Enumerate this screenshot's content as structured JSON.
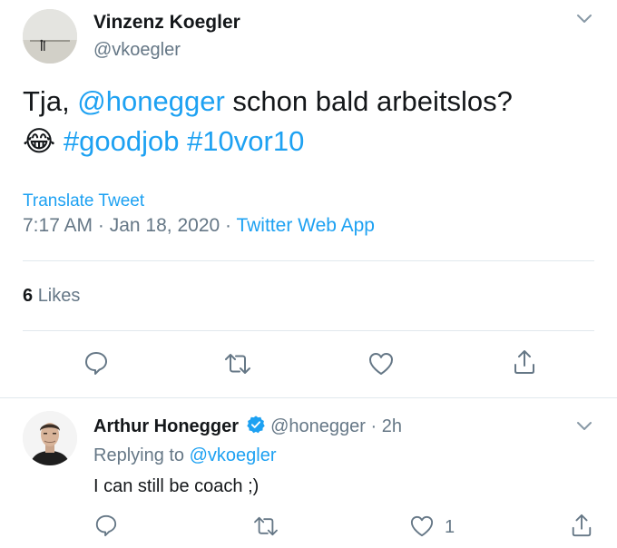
{
  "main_tweet": {
    "author_name": "Vinzenz Koegler",
    "author_handle": "@vkoegler",
    "text_prefix": "Tja, ",
    "mention": "@honegger",
    "text_rest": " schon bald arbeitslos?",
    "emoji": "😂",
    "hashtag1": "#goodjob",
    "hashtag2": "#10vor10",
    "translate_label": "Translate Tweet",
    "time": "7:17 AM",
    "dot1": " · ",
    "date": "Jan 18, 2020",
    "dot2": " · ",
    "source": "Twitter Web App",
    "likes_count": "6",
    "likes_label": "Likes"
  },
  "reply_tweet": {
    "author_name": "Arthur Honegger",
    "author_handle": "@honegger",
    "time_sep": " · ",
    "time": "2h",
    "replying_prefix": "Replying to ",
    "replying_to": "@vkoegler",
    "text": "I can still be coach ;)",
    "like_count": "1"
  },
  "colors": {
    "link": "#1da1f2",
    "muted": "#657786",
    "verified": "#1da1f2"
  },
  "icons": [
    "chevron-down-icon",
    "reply-icon",
    "retweet-icon",
    "heart-icon",
    "share-icon",
    "verified-badge-icon"
  ]
}
